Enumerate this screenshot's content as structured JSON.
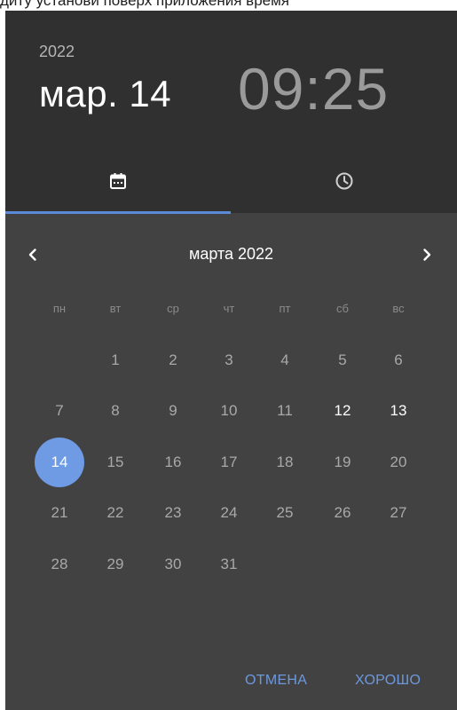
{
  "clipped_text": "диту установи поверх приложения время",
  "header": {
    "year": "2022",
    "date": "мар. 14",
    "time": "09:25"
  },
  "tabs": [
    {
      "name": "date",
      "icon": "calendar-icon",
      "selected": true
    },
    {
      "name": "time",
      "icon": "clock-icon",
      "selected": false
    }
  ],
  "calendar": {
    "month_label": "марта 2022",
    "weekdays": [
      "пн",
      "вт",
      "ср",
      "чт",
      "пт",
      "сб",
      "вс"
    ],
    "first_weekday_index": 1,
    "days_in_month": 31,
    "selected_day": 14,
    "highlighted_days": [
      12,
      13
    ]
  },
  "actions": {
    "cancel": "ОТМЕНА",
    "ok": "ХОРОШО"
  },
  "colors": {
    "accent": "#6e9be4",
    "header_bg": "#303030",
    "body_bg": "#424242"
  }
}
